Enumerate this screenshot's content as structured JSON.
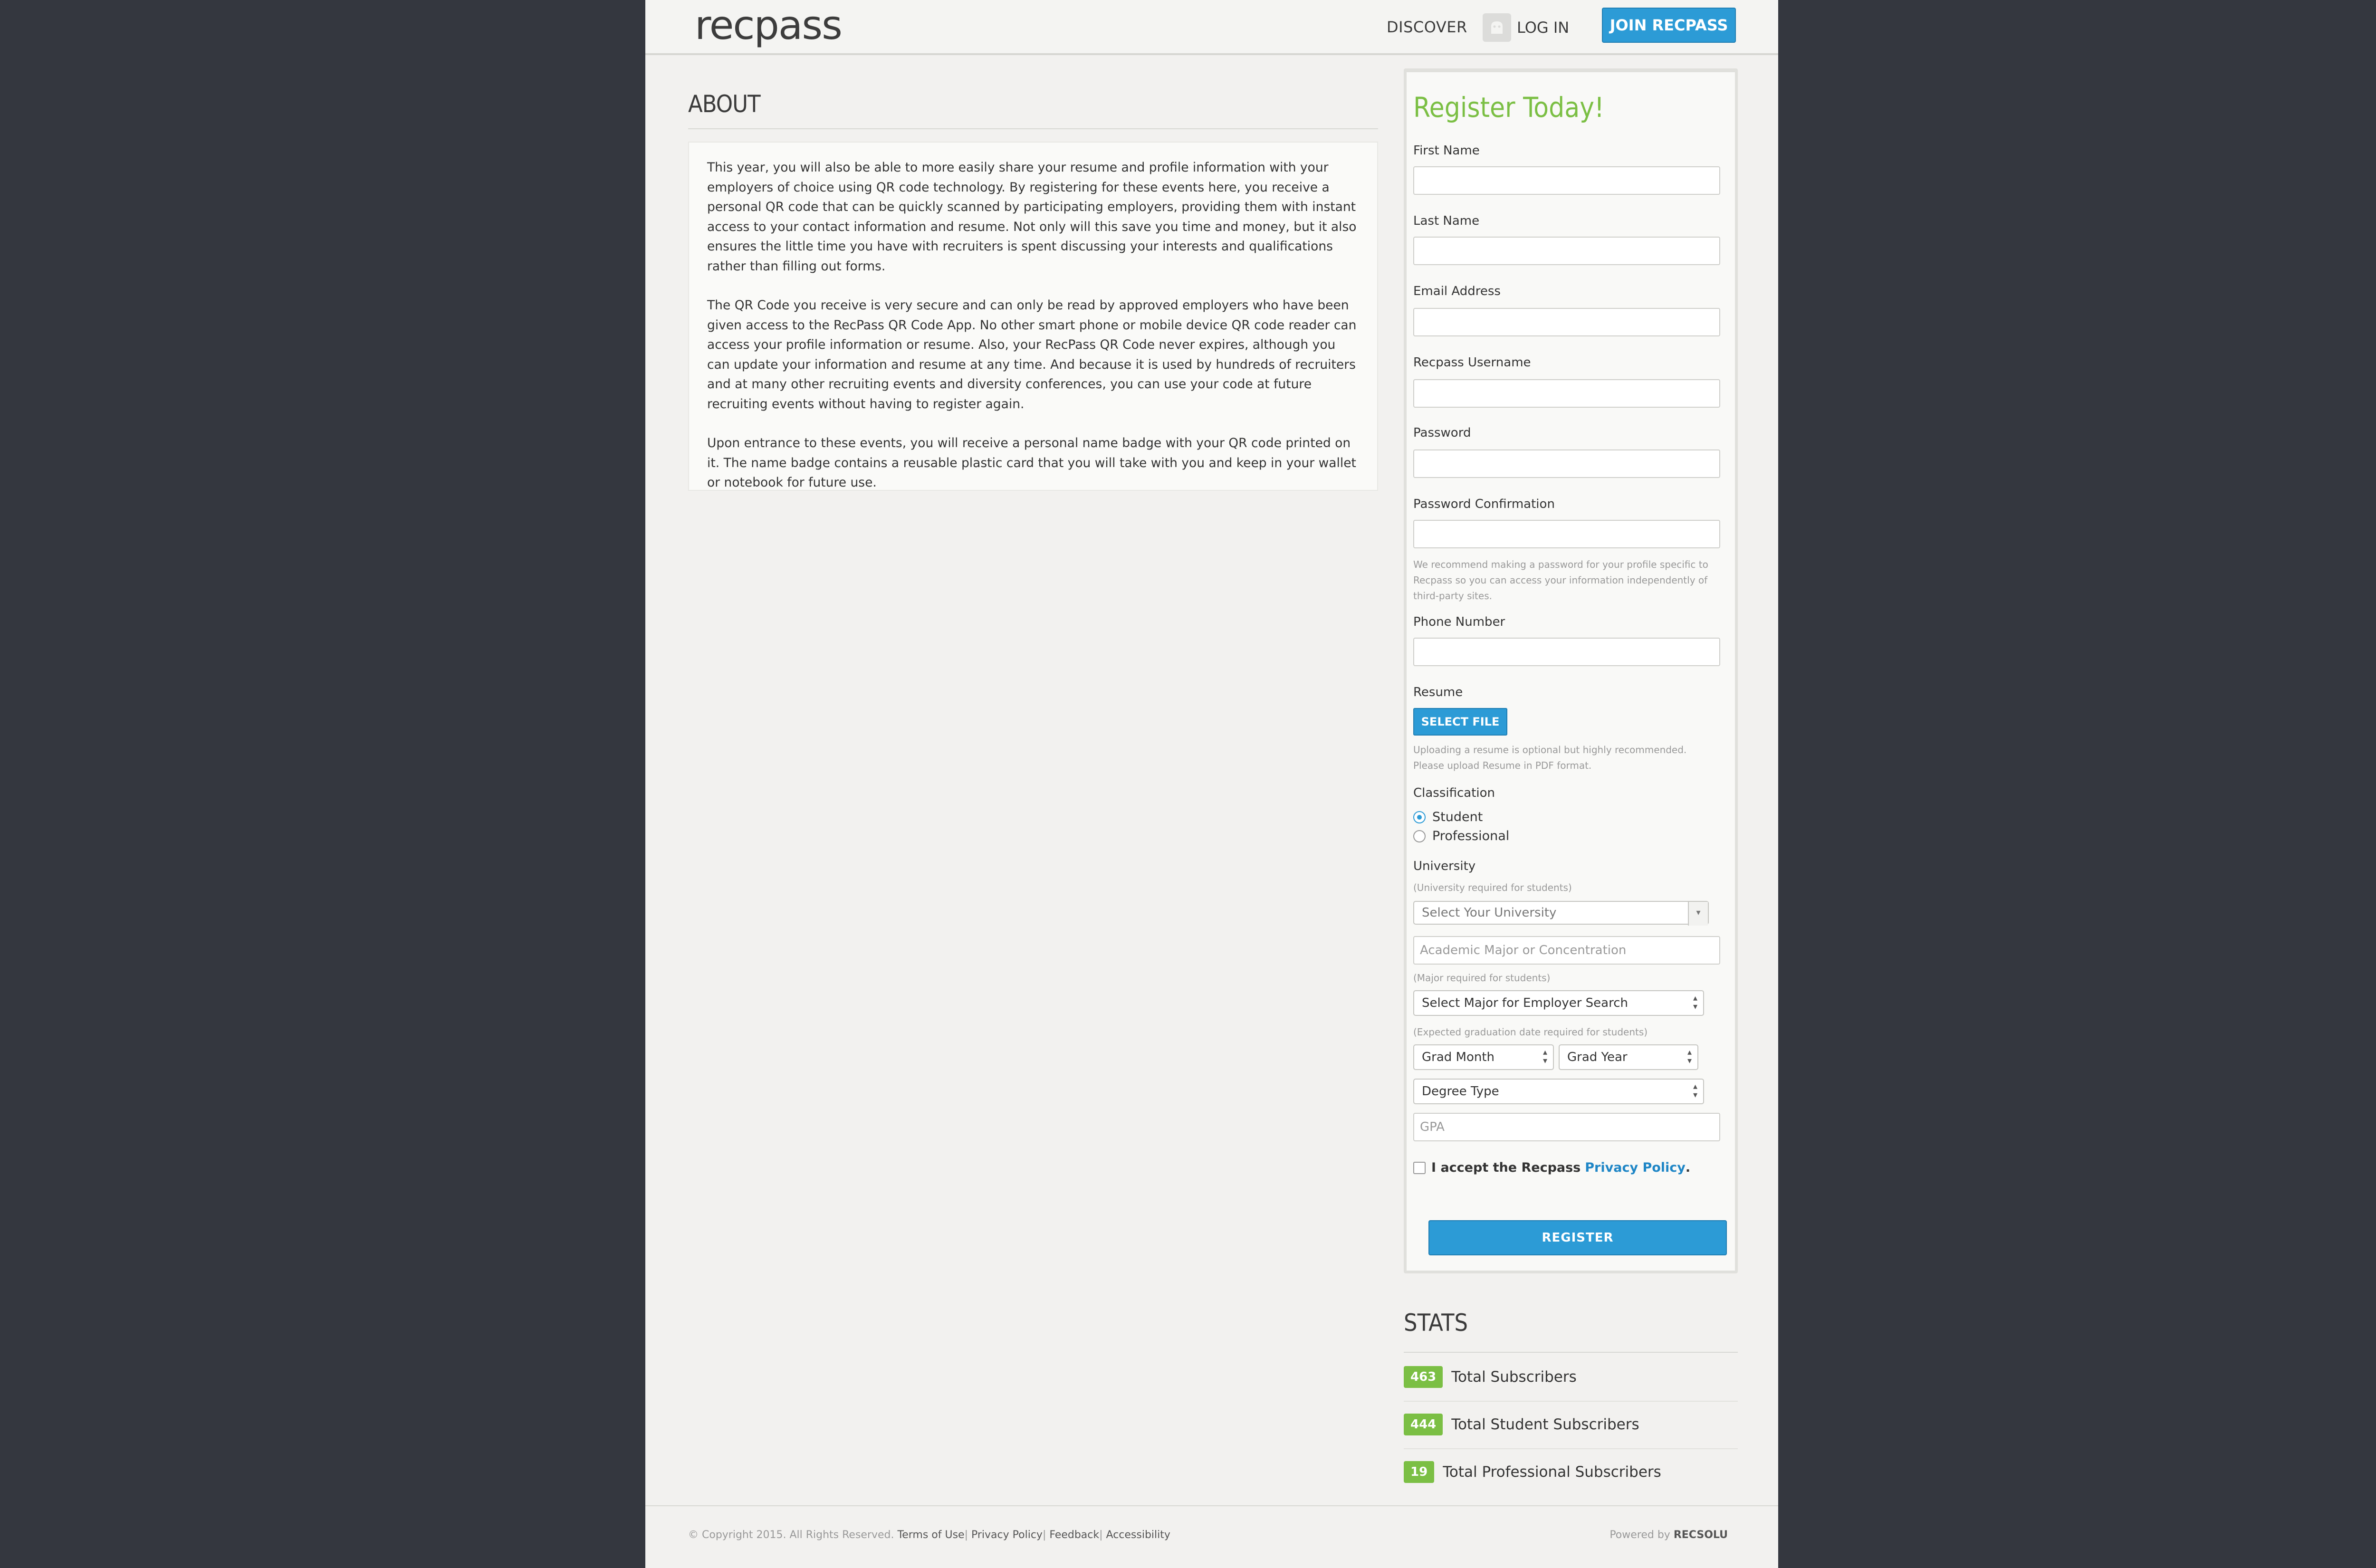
{
  "header": {
    "logo_text": "recpass",
    "nav_discover": "DISCOVER",
    "nav_login": "LOG IN",
    "join_button": "JOIN RECPASS"
  },
  "about": {
    "title": "ABOUT",
    "paragraphs": [
      "This year, you will also be able to more easily share your resume and profile information with your employers of choice using QR code technology. By registering for these events here, you receive a personal QR code that can be quickly scanned by participating employers, providing them with instant access to your contact information and resume. Not only will this save you time and money, but it also ensures the little time you have with recruiters is spent discussing your interests and qualifications rather than filling out forms.",
      "The QR Code you receive is very secure and can only be read by approved employers who have been given access to the RecPass QR Code App. No other smart phone or mobile device QR code reader can access your profile information or resume. Also, your RecPass QR Code never expires, although you can update your information and resume at any time. And because it is used by hundreds of recruiters and at many other recruiting events and diversity conferences, you can use your code at future recruiting events without having to register again.",
      "Upon entrance to these events, you will receive a personal name badge with your QR code printed on it. The name badge contains a reusable plastic card that you will take with you and keep in your wallet or notebook for future use."
    ]
  },
  "register": {
    "title": "Register Today!",
    "first_name_label": "First Name",
    "last_name_label": "Last Name",
    "email_label": "Email Address",
    "username_label": "Recpass Username",
    "password_label": "Password",
    "password_confirm_label": "Password Confirmation",
    "password_help": "We recommend making a password for your profile specific to Recpass so you can access your information independently of third-party sites.",
    "phone_label": "Phone Number",
    "resume_label": "Resume",
    "select_file_button": "SELECT FILE",
    "resume_help": "Uploading a resume is optional but highly recommended. Please upload Resume in PDF format.",
    "classification_label": "Classification",
    "classification_options": [
      "Student",
      "Professional"
    ],
    "university_label": "University",
    "university_help": "(University required for students)",
    "university_select": "Select Your University",
    "major_placeholder": "Academic Major or Concentration",
    "major_help": "(Major required for students)",
    "major_select": "Select Major for Employer Search",
    "grad_help": "(Expected graduation date required for students)",
    "grad_month": "Grad Month",
    "grad_year": "Grad Year",
    "degree_type": "Degree Type",
    "gpa_placeholder": "GPA",
    "accept_text": "I accept the Recpass",
    "privacy_link": "Privacy Policy",
    "accept_period": ".",
    "register_button": "REGISTER"
  },
  "stats": {
    "title": "STATS",
    "items": [
      {
        "count": "463",
        "label": "Total Subscribers"
      },
      {
        "count": "444",
        "label": "Total Student Subscribers"
      },
      {
        "count": "19",
        "label": "Total Professional Subscribers"
      }
    ]
  },
  "footer": {
    "copyright": "© Copyright 2015. All Rights Reserved.",
    "links": [
      "Terms of Use",
      "Privacy Policy",
      "Feedback",
      "Accessibility"
    ],
    "powered_by": "Powered by",
    "powered_brand": "RECSOLU"
  },
  "colors": {
    "accent_blue": "#2c9bd6",
    "accent_green": "#7bbf44",
    "background": "#34373f"
  }
}
